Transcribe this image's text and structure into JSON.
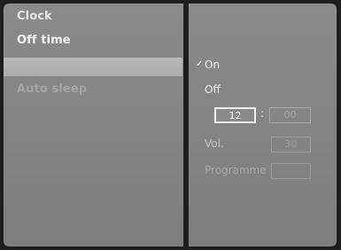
{
  "menu": {
    "items": [
      {
        "label": "Clock"
      },
      {
        "label": "Off time"
      },
      {
        "label": ""
      },
      {
        "label": "Auto sleep"
      }
    ]
  },
  "options": {
    "on_label": "On",
    "off_label": "Off",
    "selected": "On",
    "check_icon": "checkmark-icon"
  },
  "time": {
    "hour": "12",
    "separator": ":",
    "minute": "00"
  },
  "volume": {
    "label": "Vol.",
    "value": "30"
  },
  "programme": {
    "label": "Programme",
    "value": ""
  },
  "colors": {
    "panel": "#868686",
    "highlight": "#b3b3b3",
    "text": "#f2f2f2",
    "dim_text": "#a6a6a6",
    "border": "#1e1e1e"
  }
}
